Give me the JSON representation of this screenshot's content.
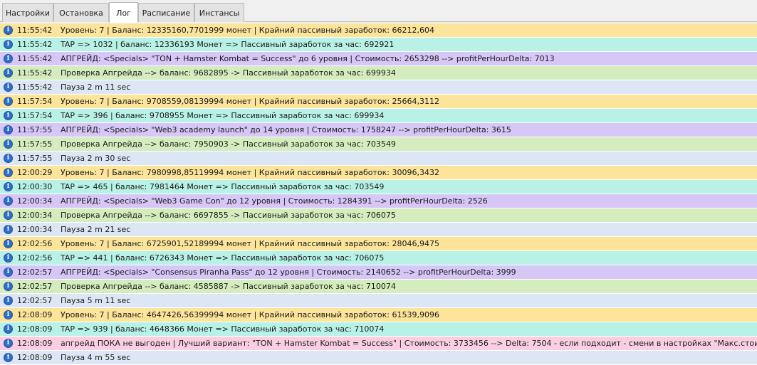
{
  "tabs": [
    {
      "label": "Настройки",
      "active": false
    },
    {
      "label": "Остановка",
      "active": false
    },
    {
      "label": "Лог",
      "active": true
    },
    {
      "label": "Расписание",
      "active": false
    },
    {
      "label": "Инстансы",
      "active": false
    }
  ],
  "icon": "info-icon",
  "colors": {
    "level": "#fce49a",
    "tap": "#b8f2e6",
    "upgrade": "#d7c7f7",
    "check": "#d5edbe",
    "pause": "#dde6f4",
    "warn": "#fbcfe2"
  },
  "log": [
    {
      "time": "11:55:42",
      "type": "level",
      "text": "Уровень: 7 | Баланс: 12335160,7701999 монет | Крайний пассивный заработок: 66212,604"
    },
    {
      "time": "11:55:42",
      "type": "tap",
      "text": "TAP => 1032 | баланс: 12336193 Монет => Пассивный заработок за час: 692921"
    },
    {
      "time": "11:55:42",
      "type": "upgrade",
      "text": "АПГРЕЙД: <Specials> \"TON + Hamster Kombat = Success\" до 6 уровня | Стоимость: 2653298 --> profitPerHourDelta: 7013"
    },
    {
      "time": "11:55:42",
      "type": "check",
      "text": "Проверка Апгрейда --> баланс: 9682895 -> Пассивный заработок за час: 699934"
    },
    {
      "time": "11:55:42",
      "type": "pause",
      "text": "Пауза 2 m 11 sec"
    },
    {
      "time": "11:57:54",
      "type": "level",
      "text": "Уровень: 7 | Баланс: 9708559,08139994 монет | Крайний пассивный заработок: 25664,3112"
    },
    {
      "time": "11:57:54",
      "type": "tap",
      "text": "TAP => 396 | баланс: 9708955 Монет => Пассивный заработок за час: 699934"
    },
    {
      "time": "11:57:55",
      "type": "upgrade",
      "text": "АПГРЕЙД: <Specials> \"Web3 academy launch\" до 14 уровня | Стоимость: 1758247 --> profitPerHourDelta: 3615"
    },
    {
      "time": "11:57:55",
      "type": "check",
      "text": "Проверка Апгрейда --> баланс: 7950903 -> Пассивный заработок за час: 703549"
    },
    {
      "time": "11:57:55",
      "type": "pause",
      "text": "Пауза 2 m 30 sec"
    },
    {
      "time": "12:00:29",
      "type": "level",
      "text": "Уровень: 7 | Баланс: 7980998,85119994 монет | Крайний пассивный заработок: 30096,3432"
    },
    {
      "time": "12:00:30",
      "type": "tap",
      "text": "TAP => 465 | баланс: 7981464 Монет => Пассивный заработок за час: 703549"
    },
    {
      "time": "12:00:34",
      "type": "upgrade",
      "text": "АПГРЕЙД: <Specials> \"Web3 Game Con\" до 12 уровня | Стоимость: 1284391 --> profitPerHourDelta: 2526"
    },
    {
      "time": "12:00:34",
      "type": "check",
      "text": "Проверка Апгрейда --> баланс: 6697855 -> Пассивный заработок за час: 706075"
    },
    {
      "time": "12:00:34",
      "type": "pause",
      "text": "Пауза 2 m 21 sec"
    },
    {
      "time": "12:02:56",
      "type": "level",
      "text": "Уровень: 7 | Баланс: 6725901,52189994 монет | Крайний пассивный заработок: 28046,9475"
    },
    {
      "time": "12:02:56",
      "type": "tap",
      "text": "TAP => 441 | баланс: 6726343 Монет => Пассивный заработок за час: 706075"
    },
    {
      "time": "12:02:57",
      "type": "upgrade",
      "text": "АПГРЕЙД: <Specials> \"Consensus Piranha Pass\" до 12 уровня | Стоимость: 2140652 --> profitPerHourDelta: 3999"
    },
    {
      "time": "12:02:57",
      "type": "check",
      "text": "Проверка Апгрейда --> баланс: 4585887 -> Пассивный заработок за час: 710074"
    },
    {
      "time": "12:02:57",
      "type": "pause",
      "text": "Пауза 5 m 11 sec"
    },
    {
      "time": "12:08:09",
      "type": "level",
      "text": "Уровень: 7 | Баланс: 4647426,56399994 монет | Крайний пассивный заработок: 61539,9096"
    },
    {
      "time": "12:08:09",
      "type": "tap",
      "text": "TAP => 939 | баланс: 4648366 Монет => Пассивный заработок за час: 710074"
    },
    {
      "time": "12:08:09",
      "type": "warn",
      "text": "апгрейд ПОКА не выгоден | Лучший вариант: \"TON + Hamster Kombat = Success\" | Стоимость: 3733456 --> Delta: 7504 - если подходит - смени в настройках \"Макс.стоимость\\Delta(минимум)\""
    },
    {
      "time": "12:08:09",
      "type": "pause",
      "text": "Пауза 4 m 55 sec"
    }
  ]
}
